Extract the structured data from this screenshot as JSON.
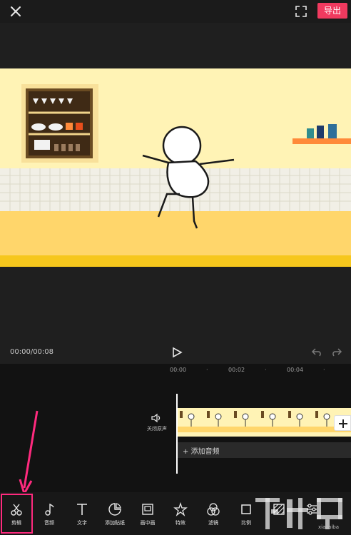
{
  "header": {
    "export_label": "导出"
  },
  "player": {
    "timecode": "00:00/00:08"
  },
  "timeline": {
    "ticks": [
      "00:00",
      "00:02",
      "00:04"
    ],
    "audio_toggle_label": "关闭原声",
    "add_audio_label": "+ 添加音频"
  },
  "toolbar": {
    "items": [
      {
        "label": "剪辑",
        "icon": "scissors-icon"
      },
      {
        "label": "音频",
        "icon": "music-note-icon"
      },
      {
        "label": "文字",
        "icon": "text-icon"
      },
      {
        "label": "添加贴纸",
        "icon": "sticker-icon"
      },
      {
        "label": "画中画",
        "icon": "picture-in-picture-icon"
      },
      {
        "label": "特效",
        "icon": "effects-icon"
      },
      {
        "label": "滤镜",
        "icon": "filter-icon"
      },
      {
        "label": "比例",
        "icon": "ratio-icon"
      },
      {
        "label": "",
        "icon": "background-icon"
      },
      {
        "label": "",
        "icon": "adjust-icon"
      }
    ]
  },
  "watermark": {
    "site": "xiazaiba"
  },
  "colors": {
    "accent": "#f03a5f",
    "highlight": "#ff2a7e"
  }
}
